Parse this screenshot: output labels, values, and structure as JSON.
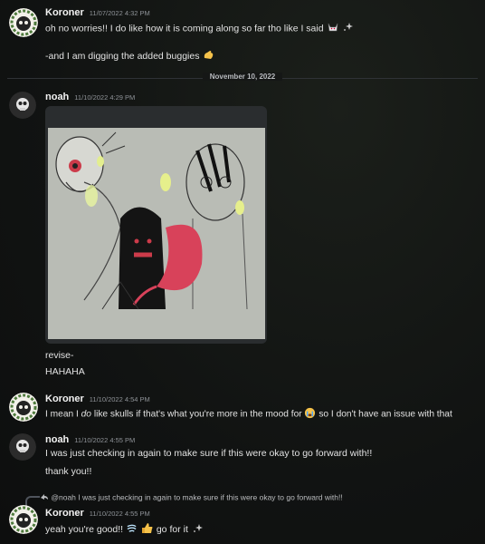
{
  "messages": [
    {
      "author": "Koroner",
      "time": "11/07/2022 4:32 PM",
      "lines": [
        "oh no worries!! I do like how it is coming along so far tho like I said",
        "-and I am digging the added buggies"
      ]
    },
    {
      "author": "noah",
      "time": "11/10/2022 4:29 PM",
      "lines": [
        "revise-",
        "HAHAHA"
      ]
    },
    {
      "author": "Koroner",
      "time": "11/10/2022 4:54 PM",
      "lines": [
        "I mean I ",
        "do",
        " like skulls if that's what you're more in the mood for",
        " so I don't have an issue with that"
      ]
    },
    {
      "author": "noah",
      "time": "11/10/2022 4:55 PM",
      "lines": [
        "I was just checking in again to make sure if this were okay to go forward with!!",
        "thank you!!"
      ]
    },
    {
      "author": "Koroner",
      "time": "11/10/2022 4:55 PM",
      "reply_preview": "@noah I was just checking in again to make sure if this were okay to go forward with!!",
      "lines": [
        "yeah you're good!!",
        "go for it"
      ]
    }
  ],
  "divider": "November 10, 2022",
  "icons": [
    "cat-emoji-icon",
    "sparkles-icon",
    "pinching-hand-icon",
    "crying-emoji-icon",
    "thumbs-up-icon",
    "wind-emoji-icon",
    "reply-arrow-icon",
    "skull-artwork"
  ],
  "colors": {
    "background": "#111312",
    "text": "#e3e3e3",
    "muted": "#8e9297",
    "skull_red": "#d8425a"
  }
}
